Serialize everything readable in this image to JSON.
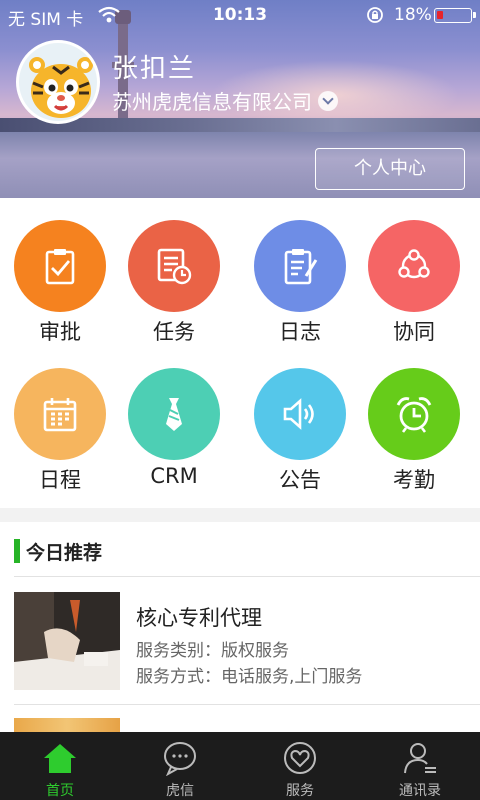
{
  "status_bar": {
    "carrier": "无 SIM 卡",
    "time": "10:13",
    "battery_percent": "18%",
    "battery_level": 0.18,
    "battery_color": "#e8242b"
  },
  "profile": {
    "name": "张扣兰",
    "company": "苏州虎虎信息有限公司",
    "center_button": "个人中心"
  },
  "apps": [
    {
      "label": "审批",
      "icon": "clipboard-check-icon",
      "color": "#f5821f"
    },
    {
      "label": "任务",
      "icon": "task-list-icon",
      "color": "#ea6346"
    },
    {
      "label": "日志",
      "icon": "notepad-pen-icon",
      "color": "#6e8de6"
    },
    {
      "label": "协同",
      "icon": "collaborate-icon",
      "color": "#f56565"
    },
    {
      "label": "日程",
      "icon": "calendar-icon",
      "color": "#f6b55e"
    },
    {
      "label": "CRM",
      "icon": "necktie-icon",
      "color": "#4dcfb4"
    },
    {
      "label": "公告",
      "icon": "speaker-icon",
      "color": "#55c7ea"
    },
    {
      "label": "考勤",
      "icon": "alarm-clock-icon",
      "color": "#66cc1a"
    }
  ],
  "recommend": {
    "title": "今日推荐",
    "items": [
      {
        "name": "核心专利代理",
        "line1": "服务类别：版权服务",
        "line2": "服务方式：电话服务,上门服务"
      }
    ]
  },
  "tabs": [
    {
      "label": "首页",
      "icon": "home-icon",
      "active": true
    },
    {
      "label": "虎信",
      "icon": "chat-bubble-icon",
      "active": false
    },
    {
      "label": "服务",
      "icon": "heart-icon",
      "active": false
    },
    {
      "label": "通讯录",
      "icon": "contacts-icon",
      "active": false
    }
  ],
  "colors": {
    "accent_green": "#27b427",
    "tab_active": "#2ecc2e",
    "tab_bar_bg": "#1c1c1c"
  }
}
